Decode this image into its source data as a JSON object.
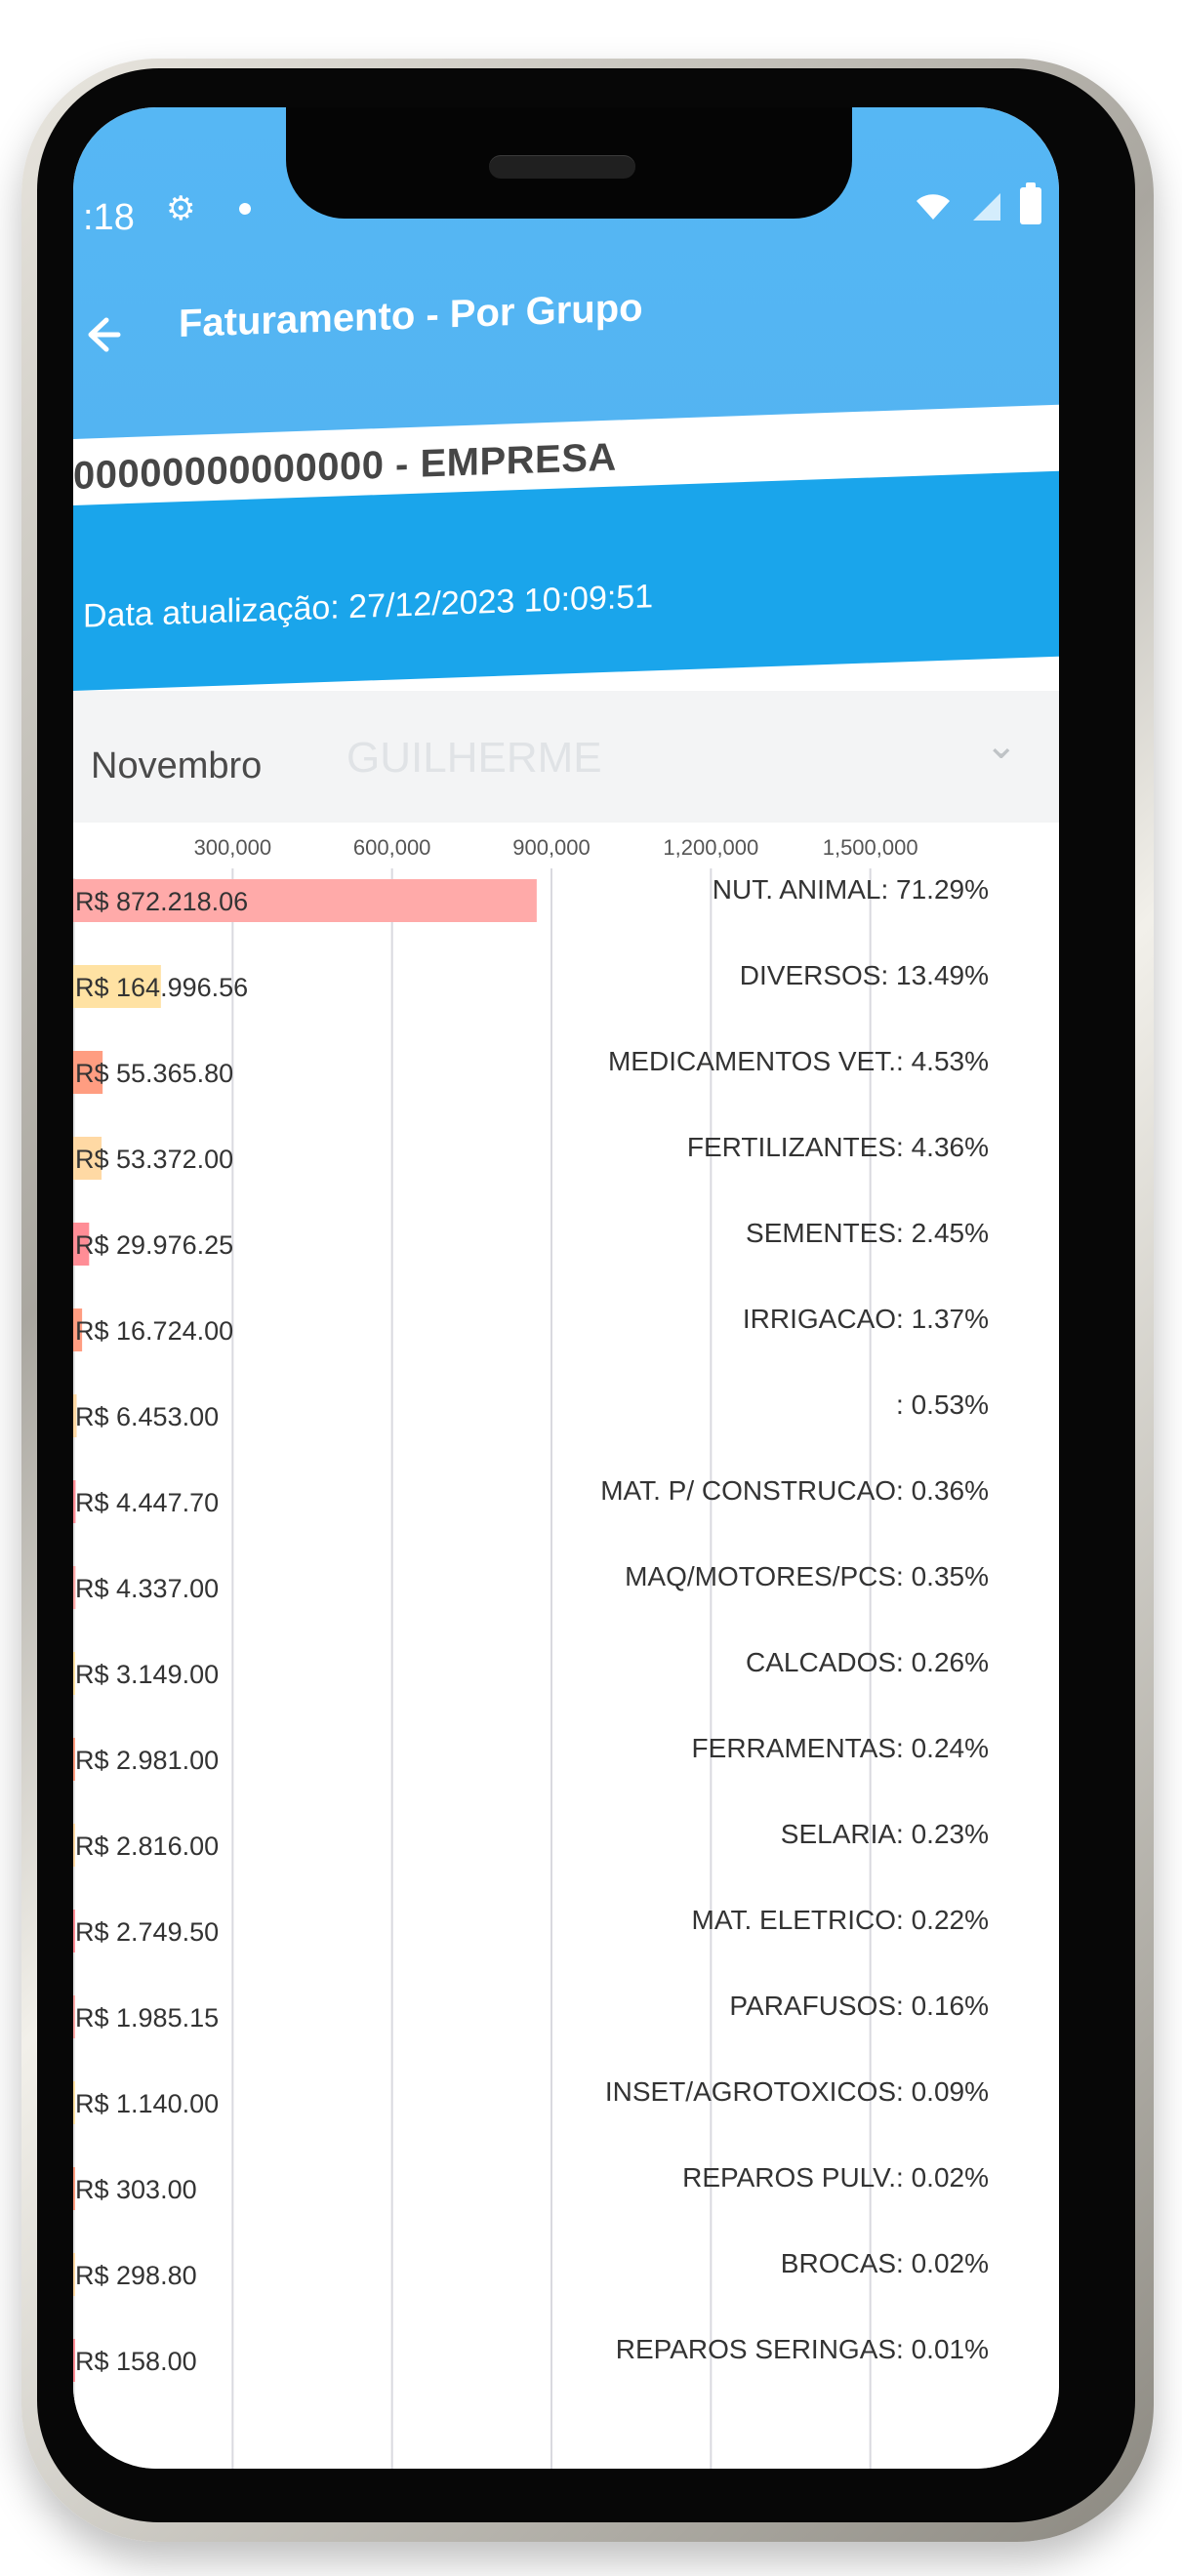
{
  "status_bar": {
    "time": ":18"
  },
  "header": {
    "title": "Faturamento - Por Grupo",
    "company": "00000000000000 - EMPRESA",
    "date_label": "Data atualização: 27/12/2023 10:09:51"
  },
  "filter": {
    "month": "Novembro",
    "user": "GUILHERME"
  },
  "chart_data": {
    "type": "bar",
    "x_ticks": [
      "300,000",
      "600,000",
      "900,000",
      "1,200,000",
      "1,500,000"
    ],
    "xlim": [
      0,
      1800000
    ],
    "grid": true,
    "categories": [
      "NUT. ANIMAL",
      "DIVERSOS",
      "MEDICAMENTOS VET.",
      "FERTILIZANTES",
      "SEMENTES",
      "IRRIGACAO",
      "",
      "MAT. P/ CONSTRUCAO",
      "MAQ/MOTORES/PCS",
      "CALCADOS",
      "FERRAMENTAS",
      "SELARIA",
      "MAT. ELETRICO",
      "PARAFUSOS",
      "INSET/AGROTOXICOS",
      "REPAROS PULV.",
      "BROCAS",
      "REPAROS SERINGAS"
    ],
    "values": [
      872218.06,
      164996.56,
      55365.8,
      53372.0,
      29976.25,
      16724.0,
      6453.0,
      4447.7,
      4337.0,
      3149.0,
      2981.0,
      2816.0,
      2749.5,
      1985.15,
      1140.0,
      303.0,
      298.8,
      158.0
    ],
    "value_labels": [
      "R$ 872.218.06",
      "R$ 164.996.56",
      "R$ 55.365.80",
      "R$ 53.372.00",
      "R$ 29.976.25",
      "R$ 16.724.00",
      "R$ 6.453.00",
      "R$ 4.447.70",
      "R$ 4.337.00",
      "R$ 3.149.00",
      "R$ 2.981.00",
      "R$ 2.816.00",
      "R$ 2.749.50",
      "R$ 1.985.15",
      "R$ 1.140.00",
      "R$ 303.00",
      "R$ 298.80",
      "R$ 158.00"
    ],
    "percent_labels": [
      "NUT. ANIMAL: 71.29%",
      "DIVERSOS: 13.49%",
      "MEDICAMENTOS VET.: 4.53%",
      "FERTILIZANTES: 4.36%",
      "SEMENTES: 2.45%",
      "IRRIGACAO: 1.37%",
      ": 0.53%",
      "MAT. P/ CONSTRUCAO: 0.36%",
      "MAQ/MOTORES/PCS: 0.35%",
      "CALCADOS: 0.26%",
      "FERRAMENTAS: 0.24%",
      "SELARIA: 0.23%",
      "MAT. ELETRICO: 0.22%",
      "PARAFUSOS: 0.16%",
      "INSET/AGROTOXICOS: 0.09%",
      "REPAROS PULV.: 0.02%",
      "BROCAS: 0.02%",
      "REPAROS SERINGAS: 0.01%"
    ],
    "colors": [
      "#ffaaa9",
      "#ffe2a3",
      "#ff9d81",
      "#ffd9a4",
      "#ff8d96",
      "#ff9d81",
      "#ffd9a4",
      "#ff8d96",
      "#ffaaa9",
      "#ffe2a3",
      "#ff9d81",
      "#ffd9a4",
      "#ff8d96",
      "#ffaaa9",
      "#ffe2a3",
      "#ff9d81",
      "#ffd9a4",
      "#ff8d96"
    ]
  }
}
